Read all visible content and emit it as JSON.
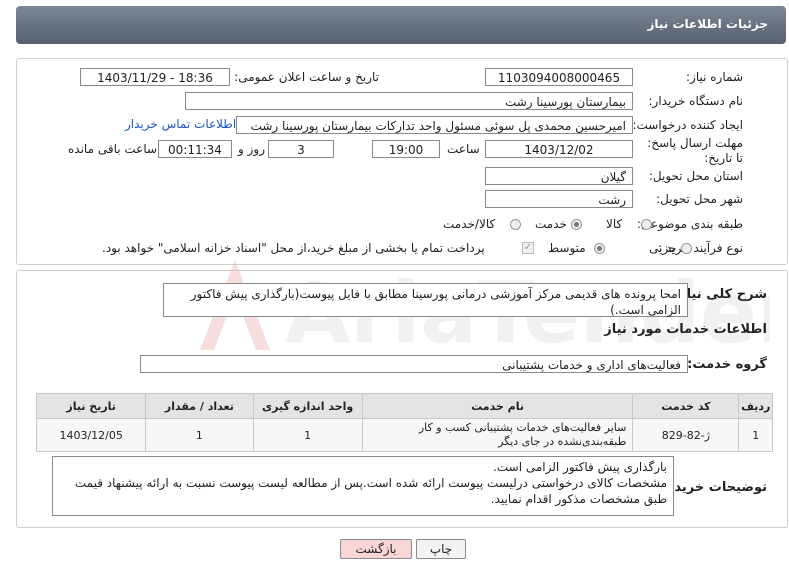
{
  "header": {
    "title": "جزئیات اطلاعات نیاز"
  },
  "form": {
    "need_number_label": "شماره نیاز:",
    "need_number": "1103094008000465",
    "announce_label": "تاریخ و ساعت اعلان عمومی:",
    "announce_value": "1403/11/29 - 18:36",
    "buyer_label": "نام دستگاه خریدار:",
    "buyer_value": "بیمارستان پورسینا رشت",
    "creator_label": "ایجاد کننده درخواست:",
    "creator_value": "امیرحسین محمدی پل سوئی مسئول واحد تدارکات بیمارستان پورسینا رشت",
    "contact_link": "اطلاعات تماس خریدار",
    "deadline_label": "مهلت ارسال پاسخ: تا تاریخ:",
    "deadline_date": "1403/12/02",
    "time_label": "ساعت",
    "deadline_time": "19:00",
    "days_value": "3",
    "days_label": "روز و",
    "remaining_value": "00:11:34",
    "remaining_label": "ساعت باقی مانده",
    "province_label": "استان محل تحویل:",
    "province_value": "گیلان",
    "city_label": "شهر محل تحویل:",
    "city_value": "رشت",
    "category_label": "طبقه بندی موضوعی:",
    "category_options": [
      "کالا",
      "خدمت",
      "کالا/خدمت"
    ],
    "category_selected": "خدمت",
    "process_label": "نوع فرآیند خرید :",
    "process_options": [
      "جزیی",
      "متوسط"
    ],
    "process_selected": "متوسط",
    "payment_note": "پرداخت تمام یا بخشی از مبلغ خرید،از محل \"اسناد خزانه اسلامی\" خواهد بود."
  },
  "summary": {
    "label": "شرح کلی نیاز:",
    "text": "امحا پرونده های قدیمی مرکز آموزشی درمانی پورسینا مطابق با فایل پیوست(بارگذاری پیش فاکتور الزامی است.)"
  },
  "services": {
    "section_title": "اطلاعات خدمات مورد نیاز",
    "group_label": "گروه خدمت:",
    "group_value": "فعالیت‌های اداری و خدمات پشتیبانی",
    "columns": [
      "ردیف",
      "کد خدمت",
      "نام خدمت",
      "واحد اندازه گیری",
      "تعداد / مقدار",
      "تاریخ نیاز"
    ],
    "rows": [
      [
        "1",
        "ژ-82-829",
        "سایر فعالیت‌های خدمات پشتیبانی کسب و کار طبقه‌بندی‌نشده در جای دیگر",
        "1",
        "1",
        "1403/12/05"
      ]
    ]
  },
  "buyer_notes": {
    "label": "توضیحات خریدار:",
    "line1": "بارگذاری پیش فاکتور الزامی است.",
    "line2": "مشخصات کالای درخواستی درلیست پیوست ارائه شده است.پس از مطالعه لیست پیوست نسبت به ارائه پیشنهاد قیمت طبق مشخصات مذکور اقدام نمایید."
  },
  "buttons": {
    "print": "چاپ",
    "back": "بازگشت"
  },
  "colors": {
    "header": "#6b7582",
    "link": "#1a56c4",
    "back_button": "#f9d6d6",
    "watermark": "#e9a1a1"
  },
  "watermark": {
    "text": "AriaTender.neT"
  }
}
